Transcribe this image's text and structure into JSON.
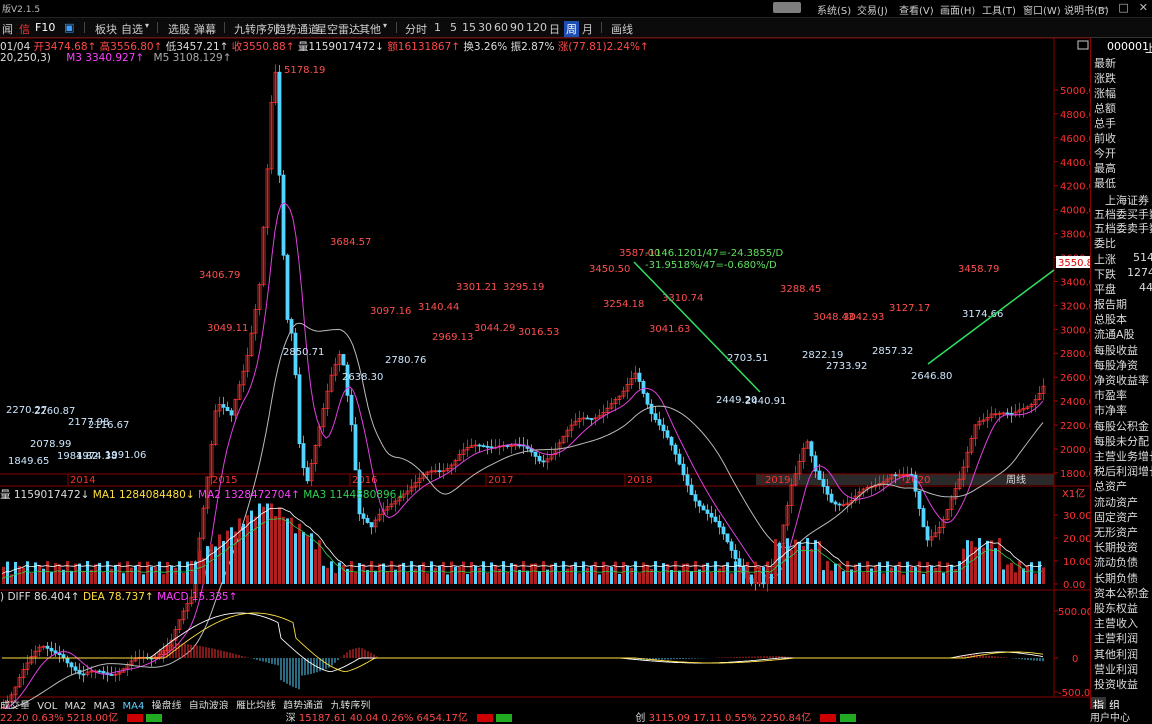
{
  "title": {
    "app": "版V2.1.5",
    "version_badge": ""
  },
  "menu": [
    "系统(S)",
    "交易(J)",
    "查看(V)",
    "画面(H)",
    "工具(T)",
    "窗口(W)",
    "说明书(B)"
  ],
  "toolbar": {
    "items": [
      "闻",
      "信",
      "F10",
      "板块",
      "自选",
      "选股",
      "弹幕",
      "九转序列",
      "趋势通道",
      "星空雷达",
      "其他",
      "分时",
      "1",
      "5",
      "15",
      "30",
      "60",
      "90",
      "120",
      "日",
      "周",
      "月",
      "画线"
    ],
    "active": "周"
  },
  "info": {
    "date": "01/04",
    "open": "开3474.68↑",
    "high": "高3556.80↑",
    "low": "低3457.21↑",
    "close": "收3550.88↑",
    "volume": "量1159017472↓",
    "amount": "额16131867↑",
    "turnover": "换3.26%",
    "amplitude": "振2.87%",
    "change": "涨(77.81)2.24%↑",
    "params": "20,250,3)",
    "ma3": "M3  3340.927↑",
    "ma5": "M5  3108.129↑"
  },
  "price_axis": [
    "5000.00",
    "4800.00",
    "4600.00",
    "4400.00",
    "4200.00",
    "4000.00",
    "3800.00",
    "3600.00",
    "3400.00",
    "3200.00",
    "3000.00",
    "2800.00",
    "2600.00",
    "2400.00",
    "2200.00",
    "2000.00",
    "1800.00"
  ],
  "current_price": "3550.88",
  "year_axis": [
    "2014",
    "2015",
    "2016",
    "2017",
    "2018",
    "2019",
    "2020"
  ],
  "period_label": "周线",
  "peak_labels": [
    "5178.19",
    "3684.57",
    "3406.79",
    "3049.11",
    "2850.71",
    "2638.30",
    "3097.16",
    "2780.76",
    "3140.44",
    "2969.13",
    "3301.21",
    "3044.29",
    "3295.19",
    "3016.53",
    "3450.50",
    "3587.00",
    "3254.18",
    "3310.74",
    "3041.63",
    "2703.51",
    "2449.20",
    "2440.91",
    "3288.45",
    "2822.19",
    "3048.43",
    "3042.93",
    "2733.92",
    "3127.17",
    "2857.32",
    "2646.80",
    "3458.79",
    "3174.66",
    "2270.27",
    "2260.87",
    "2177.98",
    "2078.99",
    "2116.67",
    "1984.82",
    "1974.38",
    "1991.06",
    "1849.65"
  ],
  "annotation": {
    "line1": "-1146.1201/47=-24.3855/D",
    "line2": "-31.9518%/47=-0.680%/D"
  },
  "volume_info": {
    "vol": "量 1159017472↓",
    "ma1": "MA1 1284084480↓",
    "ma2": "MA2 1328472704↑",
    "ma3": "MA3 1144880896↓"
  },
  "volume_unit": "X1亿",
  "volume_axis": [
    "30.00",
    "20.00",
    "10.00",
    "0.00"
  ],
  "macd_info": {
    "params": ")",
    "diff": "DIFF 86.404↑",
    "dea": "DEA 78.737↑",
    "macd": "MACD 15.335↑"
  },
  "macd_axis": [
    "500.00",
    "0",
    "-500.00"
  ],
  "right_panel": {
    "code": "000001",
    "suffix": "上",
    "rows_top": [
      "最新",
      "涨跌",
      "涨幅",
      "总额",
      "总手",
      "前收",
      "今开",
      "最高",
      "最低"
    ],
    "exchange": "上海证券",
    "rows_mid": [
      "五档委买手数",
      "五档委卖手数",
      "委比"
    ],
    "up_label": "上涨",
    "up_value": "514",
    "down_label": "下跌",
    "down_value": "1274",
    "flat_label": "平盘",
    "flat_value": "44",
    "rows_bottom": [
      "报告期",
      "总股本",
      "流通A股",
      "每股收益",
      "每股净资",
      "净资收益率",
      "市盈率",
      "市净率",
      "每股公积金",
      "每股未分配",
      "主营业务增长",
      "税后利润增长",
      "总资产",
      "流动资产",
      "固定资产",
      "无形资产",
      "长期投资",
      "流动负债",
      "长期负债",
      "资本公积金",
      "股东权益",
      "主营收入",
      "主营利润",
      "其他利润",
      "营业利润",
      "投资收益"
    ]
  },
  "bottom_tabs": [
    "成交量",
    "VOL",
    "MA2",
    "MA3",
    "MA4",
    "操盘线",
    "自动波浪",
    "雁比均线",
    "趋势通道",
    "九转序列"
  ],
  "right_bottom": [
    "指",
    "组"
  ],
  "status": {
    "sh": "22.20  0.63%  5218.00亿",
    "sz_label": "深",
    "sz": "15187.61  40.04  0.26%  6454.17亿",
    "cy_label": "创",
    "cy": "3115.09  17.11  0.55%  2250.84亿",
    "user": "用户中心"
  }
}
